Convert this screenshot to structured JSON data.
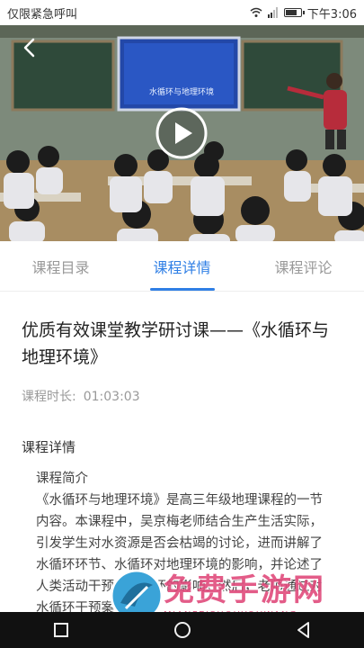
{
  "status_bar": {
    "carrier": "仅限紧急呼叫",
    "time": "下午3:06"
  },
  "video": {
    "board_text": "水循环与地理环境"
  },
  "tabs": [
    {
      "label": "课程目录",
      "active": false
    },
    {
      "label": "课程详情",
      "active": true
    },
    {
      "label": "课程评论",
      "active": false
    }
  ],
  "course": {
    "title": "优质有效课堂教学研讨课——《水循环与地理环境》",
    "duration_label": "课程时长:",
    "duration_value": "01:03:03",
    "section_heading": "课程详情",
    "intro_heading": "课程简介",
    "intro_text": "《水循环与地理环境》是高三年级地理课程的一节内容。本课程中，吴京梅老师结合生产生活实际，引发学生对水资源是否会枯竭的讨论，进而讲解了水循环环节、水循环对地理环境的影响，并论述了人类活动干预对水循环的影响。然后，老师通过对水循环干预案"
  },
  "watermark": {
    "text": "免费手游网",
    "sub": "MIANFEISHOUYOUWANG"
  },
  "colors": {
    "accent": "#2f7fe5",
    "nav_bar": "#111111"
  },
  "icons": [
    "back-arrow-icon",
    "play-icon",
    "wifi-icon",
    "signal-icon",
    "battery-icon",
    "nav-back-icon",
    "nav-home-icon",
    "nav-recents-icon"
  ]
}
